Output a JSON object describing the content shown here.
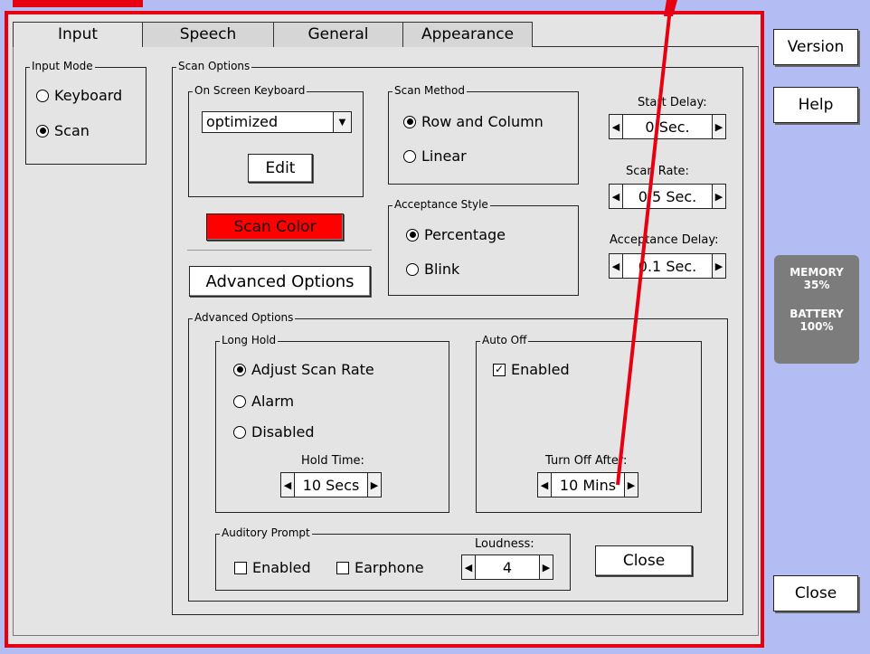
{
  "tabs": [
    "Input",
    "Speech",
    "General",
    "Appearance"
  ],
  "input_mode": {
    "legend": "Input Mode",
    "options": [
      {
        "label": "Keyboard",
        "selected": false
      },
      {
        "label": "Scan",
        "selected": true
      }
    ]
  },
  "scan_options": {
    "legend": "Scan Options",
    "on_screen_keyboard": {
      "legend": "On Screen Keyboard",
      "selected": "optimized",
      "edit_label": "Edit"
    },
    "scan_color_label": "Scan Color",
    "advanced_options_label": "Advanced Options",
    "scan_method": {
      "legend": "Scan Method",
      "options": [
        {
          "label": "Row and Column",
          "selected": true
        },
        {
          "label": "Linear",
          "selected": false
        }
      ]
    },
    "acceptance_style": {
      "legend": "Acceptance Style",
      "options": [
        {
          "label": "Percentage",
          "selected": true
        },
        {
          "label": "Blink",
          "selected": false
        }
      ]
    },
    "start_delay": {
      "label": "Start Delay:",
      "value": "0 Sec."
    },
    "scan_rate": {
      "label": "Scan Rate:",
      "value": "0.5 Sec."
    },
    "acceptance_delay": {
      "label": "Acceptance Delay:",
      "value": "0.1 Sec."
    }
  },
  "advanced": {
    "legend": "Advanced Options",
    "long_hold": {
      "legend": "Long Hold",
      "options": [
        {
          "label": "Adjust Scan Rate",
          "selected": true
        },
        {
          "label": "Alarm",
          "selected": false
        },
        {
          "label": "Disabled",
          "selected": false
        }
      ],
      "hold_time_label": "Hold Time:",
      "hold_time_value": "10 Secs"
    },
    "auto_off": {
      "legend": "Auto Off",
      "enabled_label": "Enabled",
      "enabled": true,
      "turn_off_label": "Turn Off After:",
      "turn_off_value": "10 Mins"
    },
    "auditory_prompt": {
      "legend": "Auditory Prompt",
      "enabled_label": "Enabled",
      "earphone_label": "Earphone",
      "loudness_label": "Loudness:",
      "loudness_value": "4"
    },
    "close_label": "Close"
  },
  "side": {
    "version_label": "Version",
    "help_label": "Help",
    "memory_label": "MEMORY",
    "memory_value": "35%",
    "battery_label": "BATTERY",
    "battery_value": "100%",
    "close_label": "Close"
  },
  "colors": {
    "highlight": "#e60012",
    "background": "#b4bcf4",
    "panel": "#e4e4e4",
    "scan_color": "#ff0000"
  }
}
